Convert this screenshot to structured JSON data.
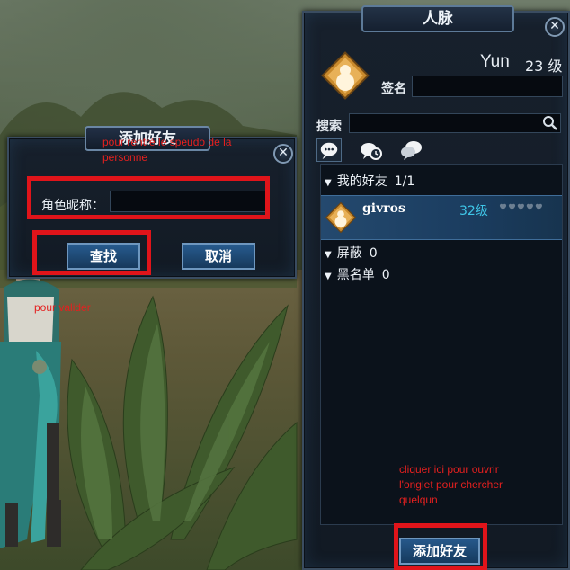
{
  "friends_panel": {
    "title": "人脉",
    "close_icon": "close-icon",
    "profile": {
      "name": "Yun",
      "level": "23 级",
      "avatar_icon": "gourd-icon",
      "sign_label": "签名",
      "sign_value": ""
    },
    "search": {
      "label": "搜索",
      "value": "",
      "icon": "search-icon"
    },
    "tabs": [
      {
        "icon": "chat-bubble-icon",
        "active": true
      },
      {
        "icon": "recent-clock-icon",
        "active": false
      },
      {
        "icon": "group-chat-icon",
        "active": false
      }
    ],
    "groups": [
      {
        "label": "我的好友",
        "count": "1/1"
      },
      {
        "label": "屏蔽",
        "count": "0"
      },
      {
        "label": "黑名单",
        "count": "0"
      }
    ],
    "friend": {
      "name": "givros",
      "level": "32级",
      "hearts": "♥♥♥♥♥",
      "avatar_icon": "gourd-icon"
    },
    "add_button": "添加好友"
  },
  "add_dialog": {
    "title": "添加好友",
    "close_icon": "close-icon",
    "nickname_label": "角色昵称：",
    "nickname_value": "",
    "search_button": "查找",
    "cancel_button": "取消"
  },
  "annotations": {
    "note_nickname": "pour rentré le speudo de la\npersonne",
    "note_validate": "pour valider",
    "note_open_tab": "cliquer ici pour ouvrir\nl'onglet pour chercher\nquelqun",
    "color": "#e0141a"
  },
  "colors": {
    "panel_bg": "#141c26",
    "frame_border": "#3a4c60",
    "button_bg": "#275b8e",
    "level_cyan": "#3fc7e8",
    "highlight_row": "#24496e"
  }
}
